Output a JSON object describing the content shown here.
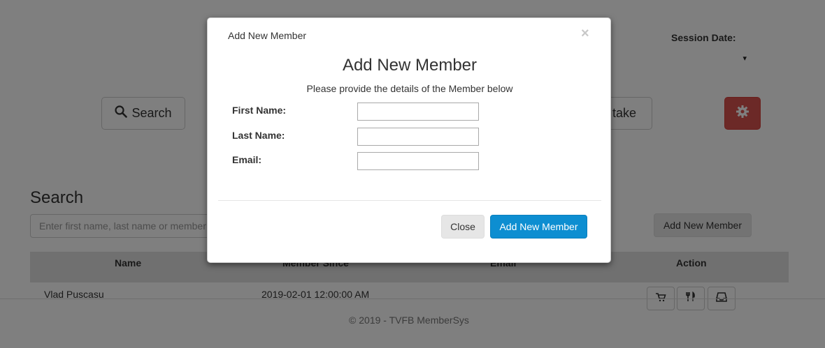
{
  "header": {
    "session_label": "Session Date:",
    "session_value": "▾"
  },
  "toolbar": {
    "search_label": "Search",
    "intake_label": "take"
  },
  "search_section": {
    "title": "Search",
    "placeholder": "Enter first name, last name or member",
    "add_button": "Add New Member"
  },
  "table": {
    "columns": [
      "Name",
      "Member Since",
      "Email",
      "Action"
    ],
    "rows": [
      {
        "name": "Vlad Puscasu",
        "member_since": "2019-02-01 12:00:00 AM",
        "email": ""
      }
    ]
  },
  "footer": {
    "text": "© 2019 - TVFB MemberSys"
  },
  "modal": {
    "title": "Add New Member",
    "close_icon": "×",
    "heading": "Add New Member",
    "subtitle": "Please provide the details of the Member below",
    "fields": [
      {
        "label": "First Name:",
        "value": ""
      },
      {
        "label": "Last Name:",
        "value": ""
      },
      {
        "label": "Email:",
        "value": ""
      }
    ],
    "close_button": "Close",
    "submit_button": "Add New Member"
  },
  "colors": {
    "primary": "#0d8ed1",
    "danger": "#d9534f"
  },
  "icons": {
    "search": "magnifier-icon",
    "settings": "gear-icon",
    "row_actions": [
      "cart-icon",
      "utensils-icon",
      "inbox-icon"
    ]
  }
}
